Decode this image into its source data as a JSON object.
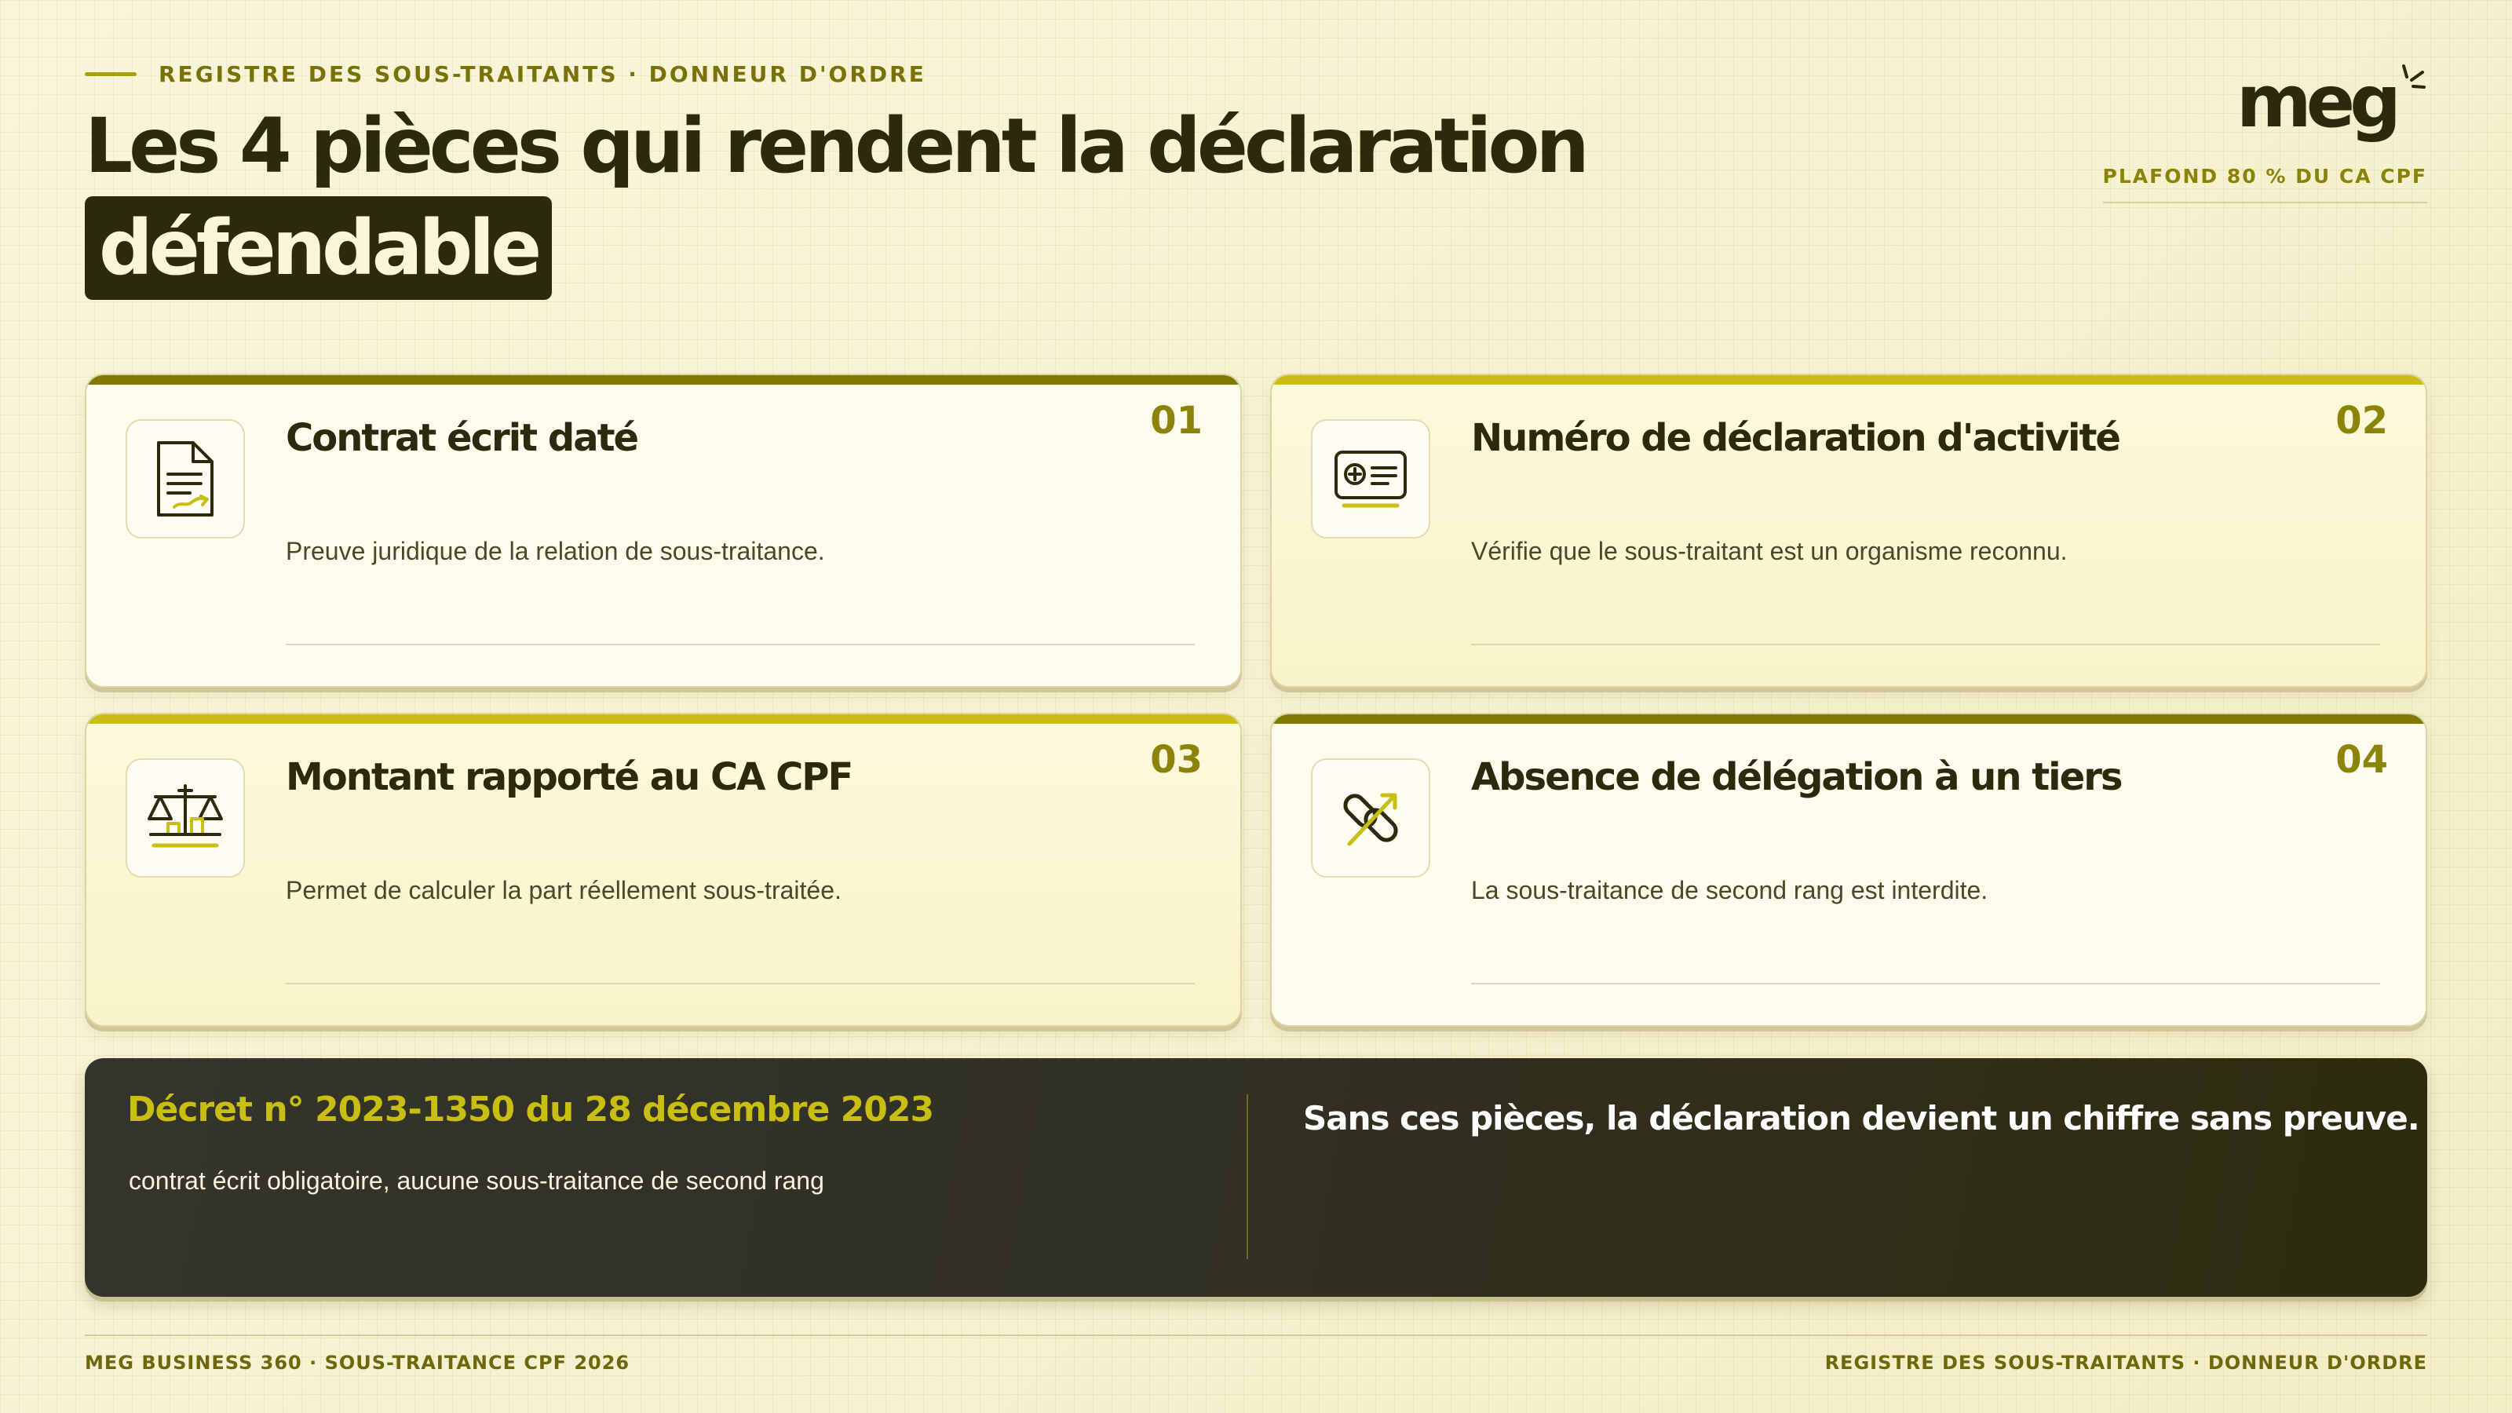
{
  "header": {
    "eyebrow": "REGISTRE DES SOUS-TRAITANTS · DONNEUR D'ORDRE",
    "title_line1": "Les 4 pièces qui rendent la déclaration",
    "title_highlight": "défendable"
  },
  "brand": {
    "logo": "meg",
    "tagline": "PLAFOND 80 % DU CA CPF"
  },
  "cards": [
    {
      "number": "01",
      "title": "Contrat écrit daté",
      "description": "Preuve juridique de la relation de sous-traitance.",
      "icon": "document-signature-icon"
    },
    {
      "number": "02",
      "title": "Numéro de déclaration d'activité",
      "description": "Vérifie que le sous-traitant est un organisme reconnu.",
      "icon": "id-card-icon"
    },
    {
      "number": "03",
      "title": "Montant rapporté au CA CPF",
      "description": "Permet de calculer la part réellement sous-traitée.",
      "icon": "balance-scale-icon"
    },
    {
      "number": "04",
      "title": "Absence de délégation à un tiers",
      "description": "La sous-traitance de second rang est interdite.",
      "icon": "broken-link-icon"
    }
  ],
  "banner": {
    "decree_title": "Décret n° 2023-1350 du 28 décembre 2023",
    "decree_subtitle": "contrat écrit obligatoire, aucune sous-traitance de second rang",
    "statement": "Sans ces pièces, la déclaration devient un chiffre sans preuve."
  },
  "footer": {
    "left": "MEG BUSINESS 360 · SOUS-TRAITANCE CPF 2026",
    "right": "REGISTRE DES SOUS-TRAITANTS · DONNEUR D'ORDRE"
  },
  "colors": {
    "background": "#f6f1cc",
    "ink": "#2b2a0c",
    "accent": "#c9be12",
    "accent_dark": "#7f7a06",
    "banner": "#31302a"
  }
}
